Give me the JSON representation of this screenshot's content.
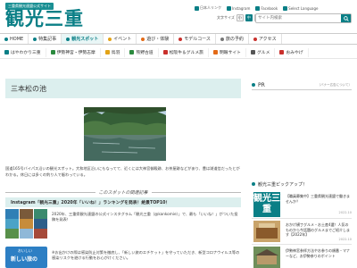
{
  "header": {
    "tagline": "三重県観光連盟公式サイト",
    "logo": "観光三重",
    "links": [
      {
        "label": "日本人リンク",
        "icon": "globe-icon",
        "color": "#0a7f86"
      },
      {
        "label": "Instagram",
        "icon": "instagram-icon",
        "color": "#0a7f86"
      },
      {
        "label": "Facebook",
        "icon": "facebook-icon",
        "color": "#0a7f86"
      },
      {
        "label": "Select Language",
        "icon": "language-icon",
        "color": "#0a7f86"
      }
    ],
    "font_size_label": "文字サイズ",
    "font_sizes": [
      "小",
      "中",
      "大"
    ],
    "font_size_active": "中",
    "search_placeholder": "サイト内検索"
  },
  "nav_main": [
    {
      "label": "HOME",
      "color": "#0a7f86"
    },
    {
      "label": "特集記事",
      "color": "#0a7f86"
    },
    {
      "label": "観光スポット",
      "color": "#0a7f86",
      "active": true
    },
    {
      "label": "イベント",
      "color": "#e3a317"
    },
    {
      "label": "遊び・体験",
      "color": "#e36a17"
    },
    {
      "label": "モデルコース",
      "color": "#c9302c"
    },
    {
      "label": "旅の予約",
      "color": "#777777"
    },
    {
      "label": "アクセス",
      "color": "#c9302c"
    }
  ],
  "nav_sub": [
    {
      "label": "はやわかり三重",
      "color": "#0a7f86"
    },
    {
      "label": "伊勢神宮・伊勢志摩",
      "color": "#2b8a3e"
    },
    {
      "label": "鳥羽",
      "color": "#e3a317"
    },
    {
      "label": "熊野古道",
      "color": "#2b8a3e"
    },
    {
      "label": "松阪牛＆グルメ旅",
      "color": "#c9302c"
    },
    {
      "label": "明眼サイト",
      "color": "#e36a17"
    },
    {
      "label": "グルメ",
      "color": "#555555"
    },
    {
      "label": "おみやげ",
      "color": "#c9302c"
    }
  ],
  "page": {
    "title": "三本松の池",
    "description": "国道165号バイパス沿いの観光スポット。大和地区沿いにもなってて、近くには大神宮御殿跡、お茶屋跡などがあり、豊は湖道信だったとがわかる。休日には多くの釣り人で賑わっている。",
    "related_heading": "このスポットの関連記事",
    "article_title": "Instagram「観光三重」2020年「いいね！」ランキングを発表！絶景TOP10！",
    "article_text": "2020年、三重県観光連盟の公式インスタグラム「観光三重（@kankomie）」で、最も「いいね！」がついた投稿を発表！",
    "banner_top": "おいしい",
    "banner_label": "新しい旅の",
    "notice": "※お出かけの際は感染防止対策を徹底し、「新しい旅のエチケット」を守っていただき、新型コロナウイルス等の感染リスクを避ける行動をお心がけください。"
  },
  "sidebar": {
    "pr_label": "PR",
    "pr_note": "（バナー広告について）",
    "pickup_heading": "観光三重ピックアップ！",
    "pickup_logo": "観光三重",
    "items": [
      {
        "text": "【職員募集中】三重県観光連盟で働きませんか？",
        "date": "2022.10"
      },
      {
        "text": "おかげ横丁グルメ・お土産4選！人気のものから今話題のグルメまでご紹介します【2022年】",
        "date": "2022.10"
      },
      {
        "text": "伊勢神宮参拝方法やお参りの順番・マナーなど、お伊勢参りのポイント",
        "date": ""
      }
    ]
  }
}
